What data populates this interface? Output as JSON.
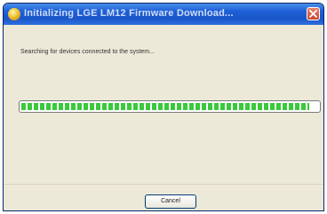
{
  "window": {
    "title": "Initializing LGE LM12 Firmware Download...",
    "title_icon": "app-globe-icon",
    "close_icon": "close-icon"
  },
  "dialog": {
    "message": "Searching for devices connected to the system..."
  },
  "progress": {
    "value_fraction": 0.97,
    "color": "#3ac93a"
  },
  "buttons": {
    "cancel_label": "Cancel"
  },
  "colors": {
    "titlebar": "#1e60d8",
    "close_button": "#c8462c",
    "dialog_background": "#ece9d8"
  }
}
